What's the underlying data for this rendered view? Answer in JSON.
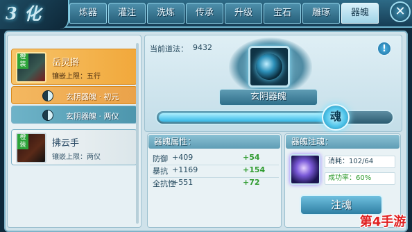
{
  "logo": {
    "text": "3 化"
  },
  "tabs": [
    {
      "label": "炼器"
    },
    {
      "label": "灌注"
    },
    {
      "label": "洗炼"
    },
    {
      "label": "传承"
    },
    {
      "label": "升级"
    },
    {
      "label": "宝石"
    },
    {
      "label": "雕琢"
    },
    {
      "label": "器魄",
      "active": true
    }
  ],
  "close_label": "✕",
  "equipment_list": [
    {
      "name": "岳灵擀",
      "sub": "镶嵌上限：五行",
      "tag": "橙装",
      "selected": true
    },
    {
      "sub_item": "玄阴器魄 · 初元",
      "selected": true
    },
    {
      "sub_item": "玄阴器魄 · 两仪"
    },
    {
      "name": "拂云手",
      "sub": "镶嵌上限：两仪",
      "tag": "橙装"
    }
  ],
  "dao": {
    "label": "当前道法：",
    "value": "9432"
  },
  "gem": {
    "title": "玄阴器魄",
    "progress_fraction": 0.8,
    "knob_glyph": "魂"
  },
  "attributes": {
    "header": "器魄属性：",
    "rows": [
      {
        "name": "防御",
        "value": "+409",
        "bonus": "+54"
      },
      {
        "name": "暴抗",
        "value": "+1169",
        "bonus": "+154"
      },
      {
        "name": "全抗性",
        "value": "+551",
        "bonus": "+72"
      }
    ]
  },
  "inject": {
    "header": "器魄注魂：",
    "cost": "消耗：102/64",
    "rate": "成功率：60%",
    "button": "注魂"
  },
  "watermark": "第4手游",
  "info_icon": "!"
}
